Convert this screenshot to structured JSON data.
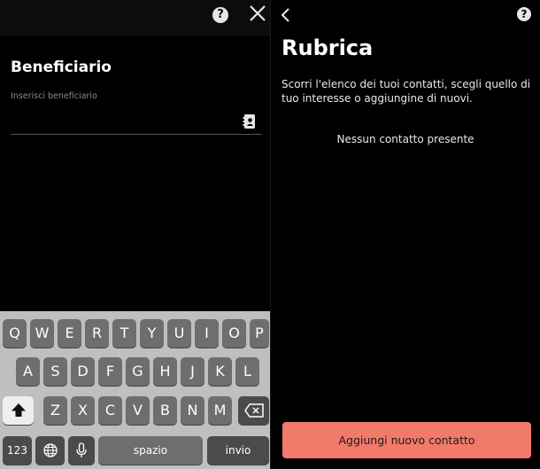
{
  "left_screen": {
    "help_symbol": "?",
    "title": "Beneficiario",
    "input_placeholder": "Inserisci beneficiario"
  },
  "keyboard": {
    "row1": [
      "Q",
      "W",
      "E",
      "R",
      "T",
      "Y",
      "U",
      "I",
      "O",
      "P"
    ],
    "row2": [
      "A",
      "S",
      "D",
      "F",
      "G",
      "H",
      "J",
      "K",
      "L"
    ],
    "row3": [
      "Z",
      "X",
      "C",
      "V",
      "B",
      "N",
      "M"
    ],
    "numbers_key": "123",
    "space_key": "spazio",
    "return_key": "invio"
  },
  "right_screen": {
    "help_symbol": "?",
    "title": "Rubrica",
    "description": "Scorri l'elenco dei tuoi contatti, scegli quello di tuo interesse o aggiungine di nuovi.",
    "empty_message": "Nessun contatto presente",
    "add_button_label": "Aggiungi nuovo contatto"
  },
  "colors": {
    "accent_button": "#f27a6a",
    "background": "#000000",
    "keyboard_bg": "#bfbfbf",
    "key_bg": "#6e6e6e"
  }
}
